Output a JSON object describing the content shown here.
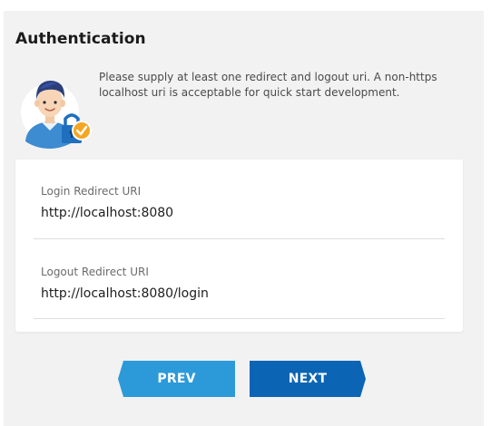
{
  "auth": {
    "title": "Authentication",
    "description": "Please supply at least one redirect and logout uri. A non-https localhost uri is acceptable for quick start development."
  },
  "form": {
    "login_redirect": {
      "label": "Login Redirect URI",
      "value": "http://localhost:8080"
    },
    "logout_redirect": {
      "label": "Logout Redirect URI",
      "value": "http://localhost:8080/login"
    }
  },
  "nav": {
    "prev_label": "PREV",
    "next_label": "NEXT"
  },
  "colors": {
    "panel_bg": "#f2f2f2",
    "prev_button": "#2c9ad9",
    "next_button": "#0b65b4",
    "badge": "#f5a623"
  },
  "icons": {
    "avatar": "user-lock-avatar-icon",
    "badge": "checkmark-badge-icon"
  }
}
